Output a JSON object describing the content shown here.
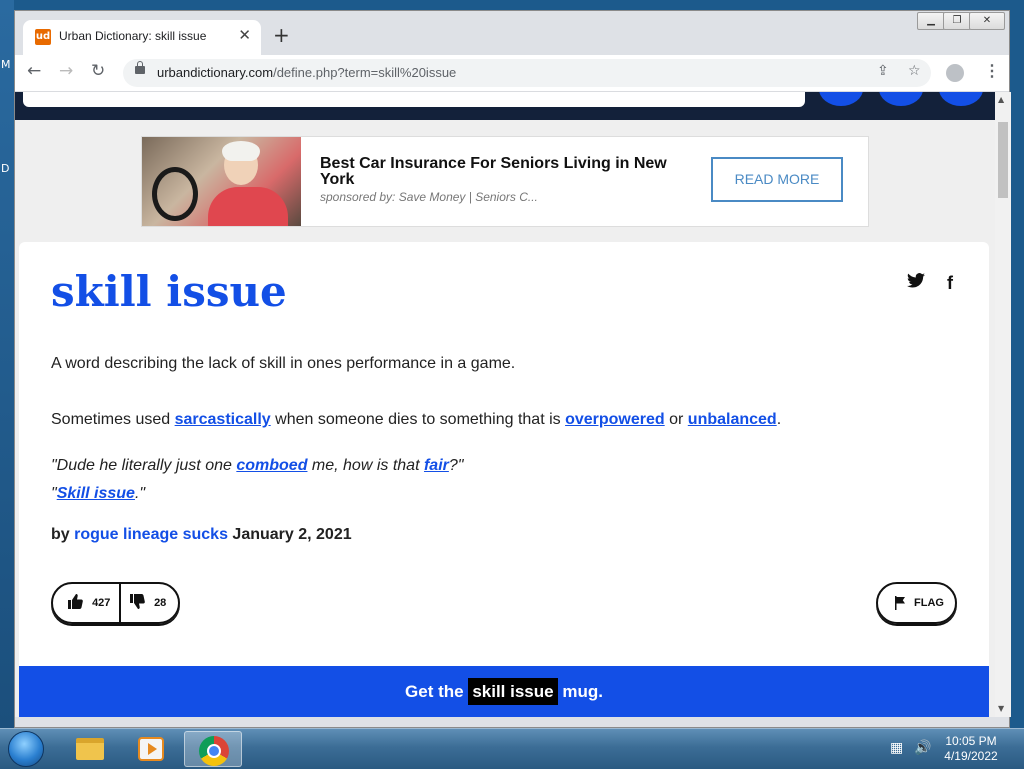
{
  "desktop": {
    "letters": [
      "M",
      "D"
    ]
  },
  "browser": {
    "tab_title": "Urban Dictionary: skill issue",
    "favicon_text": "ud",
    "new_tab": "+",
    "window_controls": [
      "▁",
      "❐",
      "✕"
    ],
    "url_host": "urbandictionary.com",
    "url_path": "/define.php?term=skill%20issue",
    "nav": {
      "back": "←",
      "forward": "→",
      "reload": "↻"
    },
    "menu": "⋮"
  },
  "ad": {
    "title": "Best Car Insurance For Seniors Living in New York",
    "sponsor": "sponsored by: Save Money | Seniors C...",
    "button": "READ MORE"
  },
  "definition": {
    "word": "skill issue",
    "meaning_line1": "A word describing the lack of skill in ones performance in a game.",
    "m2_a": "Sometimes used ",
    "m2_link1": "sarcastically",
    "m2_b": " when someone dies to something that is ",
    "m2_link2": "overpowered",
    "m2_c": " or ",
    "m2_link3": "unbalanced",
    "m2_d": ".",
    "ex1_a": "\"Dude he literally just one ",
    "ex1_link1": "comboed",
    "ex1_b": " me, how is that ",
    "ex1_link2": "fair",
    "ex1_c": "?\"",
    "ex2_a": "\"",
    "ex2_link": "Skill issue",
    "ex2_b": ".\"",
    "by_label": "by",
    "author": "rogue lineage sucks",
    "date": "January 2, 2021",
    "upvotes": "427",
    "downvotes": "28",
    "flag": "FLAG",
    "share_twitter": "twitter-icon",
    "share_facebook": "f"
  },
  "mug": {
    "prefix": "Get the",
    "term": "skill issue",
    "suffix": "mug."
  },
  "taskbar": {
    "time": "10:05 PM",
    "date": "4/19/2022"
  },
  "colors": {
    "accent": "#134fe6",
    "header": "#13213a"
  }
}
